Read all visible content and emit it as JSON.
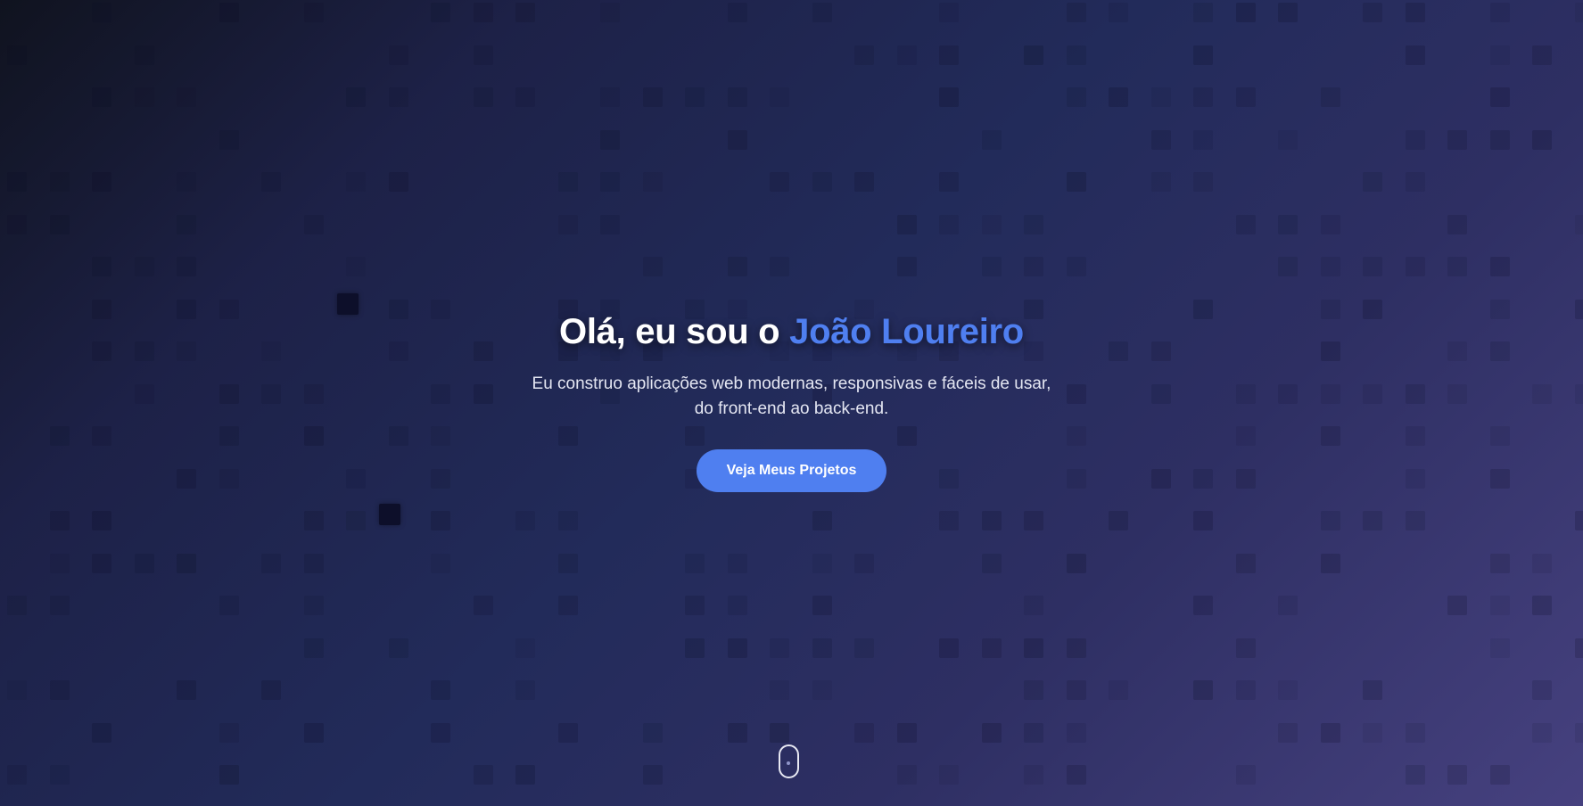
{
  "hero": {
    "title_prefix": "Olá, eu sou o ",
    "title_name": "João Loureiro",
    "subtitle_line1": "Eu construo aplicações web modernas, responsivas e fáceis de usar,",
    "subtitle_line2": "do front-end ao back-end.",
    "cta_label": "Veja Meus Projetos"
  },
  "colors": {
    "accent": "#4f7ff0",
    "title_text": "#ffffff",
    "subtitle_text": "#e4e6f2"
  },
  "icons": {
    "scroll_indicator": "mouse-scroll-icon"
  }
}
